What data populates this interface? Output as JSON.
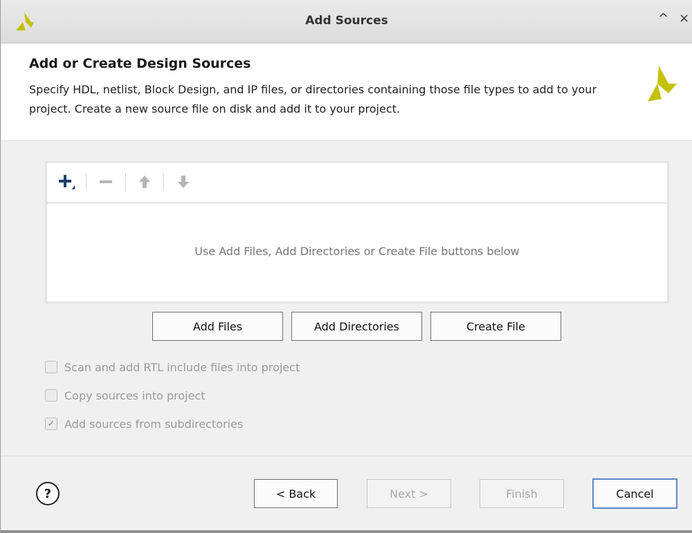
{
  "window": {
    "title": "Add Sources",
    "minimize_glyph": "^",
    "close_glyph": "×",
    "logo_color": "#c4c200"
  },
  "header": {
    "title": "Add or Create Design Sources",
    "description": "Specify HDL, netlist, Block Design, and IP files, or directories containing those file types to add to your project. Create a new source file on disk and add it to your project."
  },
  "toolbar": {
    "add_icon": "plus-icon",
    "remove_icon": "minus-icon",
    "move_up_icon": "arrow-up-icon",
    "move_down_icon": "arrow-down-icon"
  },
  "files_panel": {
    "empty_message": "Use Add Files, Add Directories or Create File buttons below"
  },
  "actions": {
    "add_files": "Add Files",
    "add_directories": "Add Directories",
    "create_file": "Create File"
  },
  "options": [
    {
      "label": "Scan and add RTL include files into project",
      "checked": false
    },
    {
      "label": "Copy sources into project",
      "checked": false
    },
    {
      "label": "Add sources from subdirectories",
      "checked": true
    }
  ],
  "footer": {
    "help": "?",
    "back": "< Back",
    "next": "Next >",
    "finish": "Finish",
    "cancel": "Cancel"
  }
}
